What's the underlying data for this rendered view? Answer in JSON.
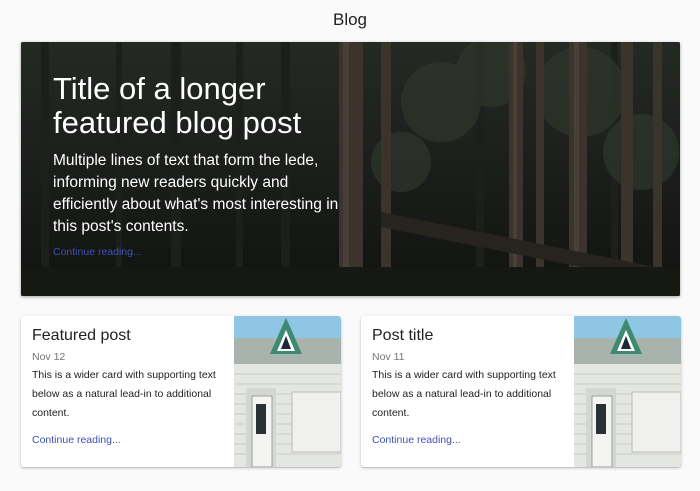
{
  "header": {
    "title": "Blog"
  },
  "hero": {
    "title": "Title of a longer featured blog post",
    "lede": "Multiple lines of text that form the lede, informing new readers quickly and efficiently about what's most interesting in this post's contents.",
    "link_label": "Continue reading..."
  },
  "cards": [
    {
      "title": "Featured post",
      "date": "Nov 12",
      "text": "This is a wider card with supporting text below as a natural lead-in to additional content.",
      "link_label": "Continue reading..."
    },
    {
      "title": "Post title",
      "date": "Nov 11",
      "text": "This is a wider card with supporting text below as a natural lead-in to additional content.",
      "link_label": "Continue reading..."
    }
  ],
  "colors": {
    "link": "#3f51b5",
    "background": "#fafafa",
    "hero_text": "#ffffff"
  }
}
